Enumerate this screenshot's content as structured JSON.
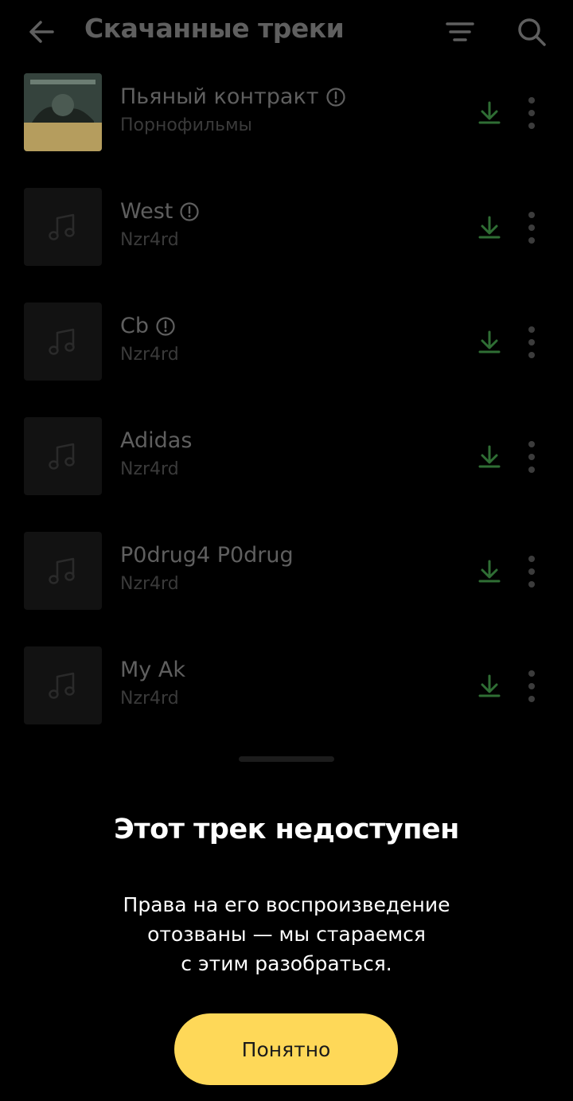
{
  "header": {
    "title": "Скачанные треки",
    "icons": {
      "back": "arrow-left-icon",
      "sort": "sort-icon",
      "search": "search-icon"
    }
  },
  "tracks": [
    {
      "title": "Пьяный контракт",
      "artist": "Порнофильмы",
      "unavailable": true,
      "cover": "album-art"
    },
    {
      "title": "West",
      "artist": "Nzr4rd",
      "unavailable": true,
      "cover": "music-note-icon"
    },
    {
      "title": "Cb",
      "artist": "Nzr4rd",
      "unavailable": true,
      "cover": "music-note-icon"
    },
    {
      "title": "Adidas",
      "artist": "Nzr4rd",
      "unavailable": false,
      "cover": "music-note-icon"
    },
    {
      "title": "P0drug4 P0drug",
      "artist": "Nzr4rd",
      "unavailable": false,
      "cover": "music-note-icon"
    },
    {
      "title": "My Ak",
      "artist": "Nzr4rd",
      "unavailable": false,
      "cover": "music-note-icon"
    }
  ],
  "sheet": {
    "title": "Этот трек недоступен",
    "message": "Права на его воспроизведение\nотозваны — мы стараемся\nс этим разобраться.",
    "button": "Понятно"
  },
  "colors": {
    "background": "#000000",
    "accent_button": "#fed858",
    "download_green": "#2f6e34",
    "muted_text": "#5f5f5f"
  }
}
